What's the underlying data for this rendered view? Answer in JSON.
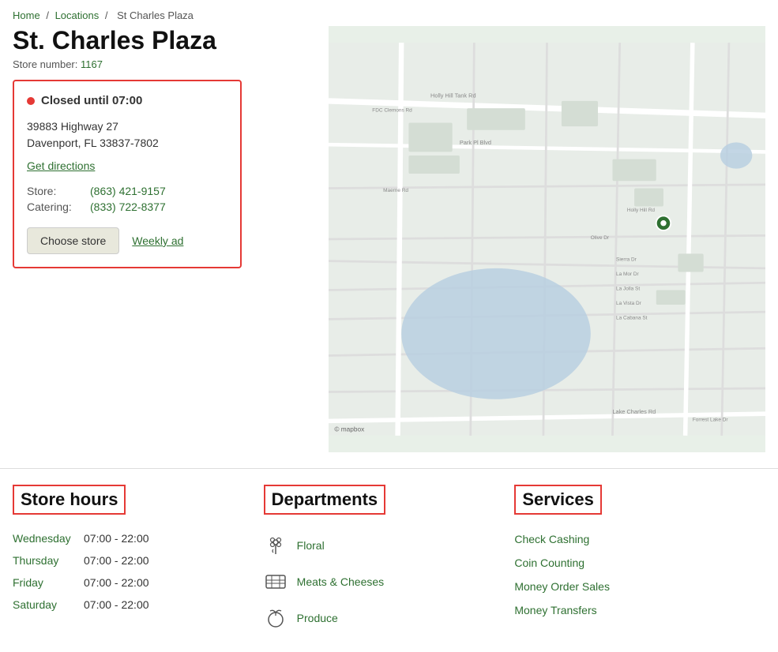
{
  "breadcrumb": {
    "home": "Home",
    "locations": "Locations",
    "current": "St Charles Plaza"
  },
  "store": {
    "title": "St. Charles Plaza",
    "store_number_label": "Store number:",
    "store_number": "1167",
    "status": "Closed until 07:00",
    "address_line1": "39883 Highway 27",
    "address_line2": "Davenport, FL 33837-7802",
    "directions_label": "Get directions",
    "phones": [
      {
        "label": "Store:",
        "number": "(863) 421-9157"
      },
      {
        "label": "Catering:",
        "number": "(833) 722-8377"
      }
    ],
    "choose_store_label": "Choose store",
    "weekly_ad_label": "Weekly ad"
  },
  "store_hours": {
    "heading": "Store hours",
    "rows": [
      {
        "day": "Wednesday",
        "hours": "07:00 - 22:00"
      },
      {
        "day": "Thursday",
        "hours": "07:00 - 22:00"
      },
      {
        "day": "Friday",
        "hours": "07:00 - 22:00"
      },
      {
        "day": "Saturday",
        "hours": "07:00 - 22:00"
      }
    ]
  },
  "departments": {
    "heading": "Departments",
    "items": [
      {
        "name": "Floral",
        "icon": "floral-icon"
      },
      {
        "name": "Meats & Cheeses",
        "icon": "meats-icon"
      },
      {
        "name": "Produce",
        "icon": "produce-icon"
      }
    ]
  },
  "services": {
    "heading": "Services",
    "items": [
      "Check Cashing",
      "Coin Counting",
      "Money Order Sales",
      "Money Transfers"
    ]
  },
  "map": {
    "attribution": "© mapbox"
  }
}
